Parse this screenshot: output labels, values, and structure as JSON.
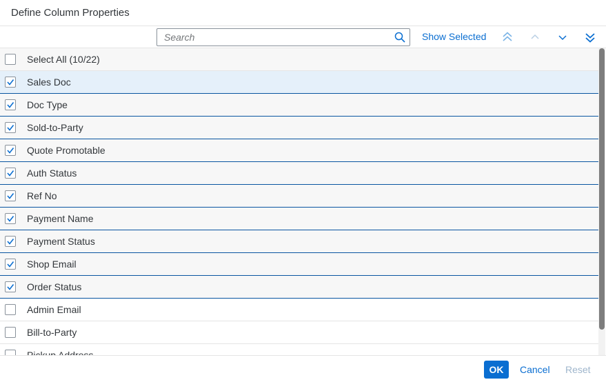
{
  "dialog": {
    "title": "Define Column Properties"
  },
  "toolbar": {
    "search_placeholder": "Search",
    "search_icon": "search-icon",
    "show_selected_label": "Show Selected",
    "move_top_icon": "double-chevron-up-icon",
    "move_up_icon": "chevron-up-icon",
    "move_down_icon": "chevron-down-icon",
    "move_bottom_icon": "double-chevron-down-icon"
  },
  "list": {
    "select_all_label": "Select All (10/22)",
    "items": [
      {
        "label": "Sales Doc",
        "checked": true
      },
      {
        "label": "Doc Type",
        "checked": true
      },
      {
        "label": "Sold-to-Party",
        "checked": true
      },
      {
        "label": "Quote Promotable",
        "checked": true
      },
      {
        "label": "Auth Status",
        "checked": true
      },
      {
        "label": "Ref No",
        "checked": true
      },
      {
        "label": "Payment Name",
        "checked": true
      },
      {
        "label": "Payment Status",
        "checked": true
      },
      {
        "label": "Shop Email",
        "checked": true
      },
      {
        "label": "Order Status",
        "checked": true
      },
      {
        "label": "Admin Email",
        "checked": false
      },
      {
        "label": "Bill-to-Party",
        "checked": false
      },
      {
        "label": "Pickup Address",
        "checked": false
      }
    ]
  },
  "footer": {
    "ok_label": "OK",
    "cancel_label": "Cancel",
    "reset_label": "Reset"
  },
  "colors": {
    "accent": "#0a6ed1",
    "selected_border": "#0854a0",
    "focus_row": "#e5f0fa",
    "disabled": "#9fb6cc"
  }
}
